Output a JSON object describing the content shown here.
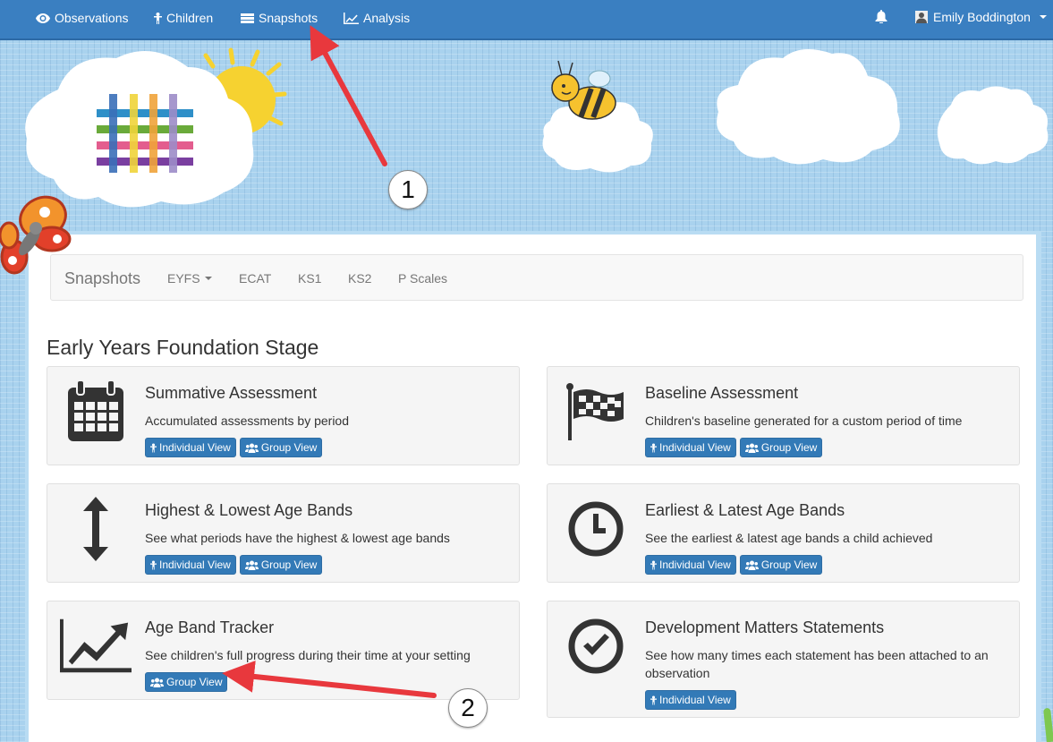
{
  "nav": {
    "items": [
      {
        "label": "Observations",
        "icon": "eye-icon"
      },
      {
        "label": "Children",
        "icon": "child-icon"
      },
      {
        "label": "Snapshots",
        "icon": "list-icon"
      },
      {
        "label": "Analysis",
        "icon": "line-chart-icon"
      }
    ],
    "user_name": "Emily Boddington"
  },
  "subnav": {
    "brand": "Snapshots",
    "items": [
      "EYFS",
      "ECAT",
      "KS1",
      "KS2",
      "P Scales"
    ]
  },
  "section_title": "Early Years Foundation Stage",
  "cards": [
    {
      "title": "Summative Assessment",
      "desc": "Accumulated assessments by period",
      "icon": "calendar-icon",
      "buttons": [
        "Individual View",
        "Group View"
      ]
    },
    {
      "title": "Baseline Assessment",
      "desc": "Children's baseline generated for a custom period of time",
      "icon": "flag-checkered-icon",
      "buttons": [
        "Individual View",
        "Group View"
      ]
    },
    {
      "title": "Highest & Lowest Age Bands",
      "desc": "See what periods have the highest & lowest age bands",
      "icon": "vertical-arrows-icon",
      "buttons": [
        "Individual View",
        "Group View"
      ]
    },
    {
      "title": "Earliest & Latest Age Bands",
      "desc": "See the earliest & latest age bands a child achieved",
      "icon": "clock-icon",
      "buttons": [
        "Individual View",
        "Group View"
      ]
    },
    {
      "title": "Age Band Tracker",
      "desc": "See children's full progress during their time at your setting",
      "icon": "area-chart-icon",
      "buttons": [
        "Group View"
      ]
    },
    {
      "title": "Development Matters Statements",
      "desc": "See how many times each statement has been attached to an observation",
      "icon": "check-circle-icon",
      "buttons": [
        "Individual View"
      ]
    }
  ],
  "annotations": [
    "1",
    "2"
  ],
  "colors": {
    "navbar": "#3a7fc1",
    "button": "#337ab7",
    "arrow": "#e8383d"
  }
}
